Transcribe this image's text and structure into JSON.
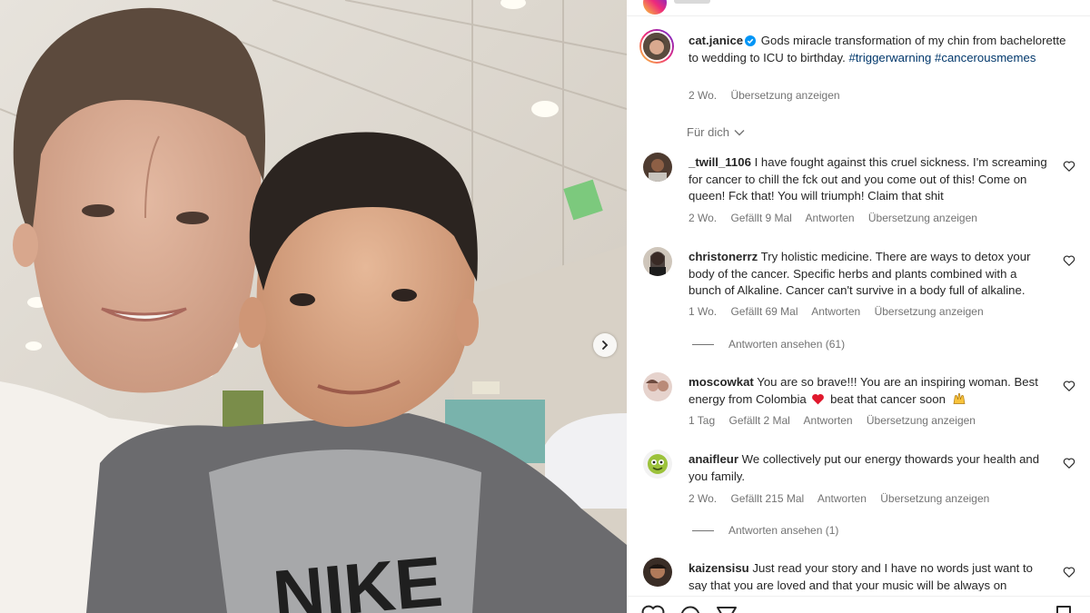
{
  "post": {
    "username": "cat.janice",
    "caption": "Gods miracle transformation of my chin from bachelorette to wedding to ICU to birthday.",
    "hashtag1": "#triggerwarning",
    "hashtag2": "#cancerousmemes",
    "time": "2 Wo.",
    "translate": "Übersetzung anzeigen",
    "sort_label": "Für dich"
  },
  "comments": [
    {
      "username": "_twill_1106",
      "text": "I have fought against this cruel sickness. I'm screaming for cancer to chill the fck out and you come out of this! Come on queen! Fck that! You will triumph! Claim that shit",
      "time": "2 Wo.",
      "likes": "Gefällt 9 Mal",
      "reply": "Antworten",
      "translate": "Übersetzung anzeigen"
    },
    {
      "username": "christonerrz",
      "text": "Try holistic medicine. There are ways to detox your body of the cancer. Specific herbs and plants combined with a bunch of Alkaline. Cancer can't survive in a body full of alkaline.",
      "time": "1 Wo.",
      "likes": "Gefällt 69 Mal",
      "reply": "Antworten",
      "translate": "Übersetzung anzeigen",
      "view_replies": "Antworten ansehen (61)"
    },
    {
      "username": "moscowkat",
      "text_a": "You are so brave!!! You are an inspiring woman. Best energy from Colombia",
      "text_b": "beat that cancer soon",
      "time": "1 Tag",
      "likes": "Gefällt 2 Mal",
      "reply": "Antworten",
      "translate": "Übersetzung anzeigen"
    },
    {
      "username": "anaifleur",
      "text": "We collectively put our energy thowards your health and you family.",
      "time": "2 Wo.",
      "likes": "Gefällt 215 Mal",
      "reply": "Antworten",
      "translate": "Übersetzung anzeigen",
      "view_replies": "Antworten ansehen (1)"
    },
    {
      "username": "kaizensisu",
      "text": "Just read your story and I have no words just want to say that you are loved and that your music will be always on"
    }
  ],
  "photo": {
    "shirt_text": "NIKE"
  },
  "icons": {
    "verified": "verified-badge-icon",
    "heart": "heart-outline-icon",
    "next": "chevron-right-icon",
    "dropdown": "chevron-down-icon",
    "like": "heart-icon",
    "comment": "comment-icon",
    "share": "send-icon",
    "save": "bookmark-icon"
  },
  "colors": {
    "link": "#00376b",
    "meta": "#737373",
    "verified": "#0095f6"
  }
}
